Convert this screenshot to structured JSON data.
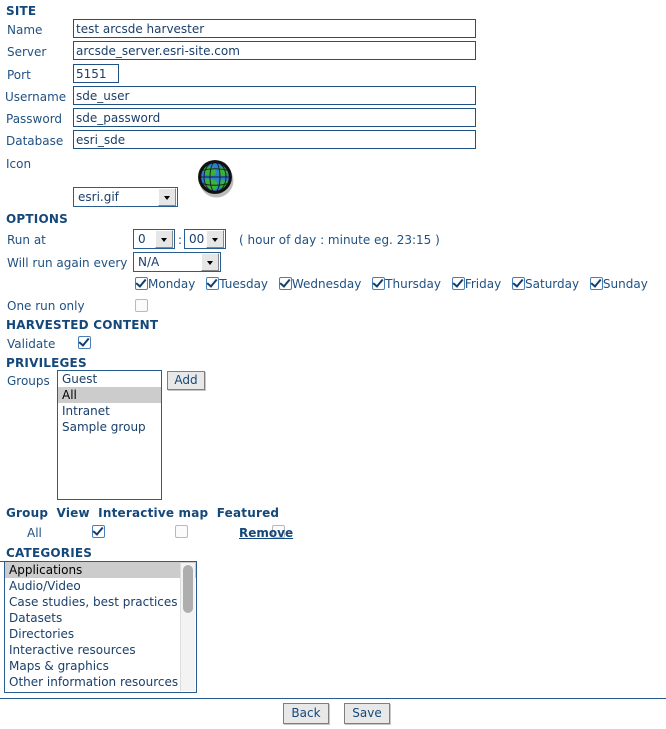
{
  "site": {
    "heading": "SITE",
    "fields": [
      {
        "label": "Name",
        "value": "test arcsde harvester"
      },
      {
        "label": "Server",
        "value": "arcsde_server.esri-site.com"
      },
      {
        "label": "Port",
        "value": "5151"
      },
      {
        "label": "Username",
        "value": "sde_user"
      },
      {
        "label": "Password",
        "value": "sde_password"
      },
      {
        "label": "Database",
        "value": "esri_sde"
      }
    ],
    "icon_label": "Icon",
    "icon_select_value": "esri.gif",
    "icon_preview_name": "esri-globe-icon"
  },
  "options": {
    "heading": "OPTIONS",
    "run_at_label": "Run at",
    "run_at_hour": "0",
    "run_at_separator": ":",
    "run_at_minute": "00",
    "run_at_hint": "( hour of day : minute eg. 23:15 )",
    "interval_label": "Will run again every",
    "interval_value": "N/A",
    "days": [
      {
        "label": "Monday",
        "checked": true
      },
      {
        "label": "Tuesday",
        "checked": true
      },
      {
        "label": "Wednesday",
        "checked": true
      },
      {
        "label": "Thursday",
        "checked": true
      },
      {
        "label": "Friday",
        "checked": true
      },
      {
        "label": "Saturday",
        "checked": true
      },
      {
        "label": "Sunday",
        "checked": true
      }
    ],
    "one_run_only_label": "One run only",
    "one_run_only_checked": false
  },
  "harvested_content": {
    "heading": "HARVESTED CONTENT",
    "validate_label": "Validate",
    "validate_checked": true
  },
  "privileges": {
    "heading": "PRIVILEGES",
    "groups_label": "Groups",
    "group_options": [
      "Guest",
      "All",
      "Intranet",
      "Sample group"
    ],
    "group_selected": "All",
    "add_button": "Add",
    "table_headers": [
      "Group",
      "View",
      "Interactive map",
      "Featured"
    ],
    "rows": [
      {
        "group": "All",
        "view": true,
        "interactive_map": false,
        "featured": false,
        "remove_label": "Remove"
      }
    ]
  },
  "categories": {
    "heading": "CATEGORIES",
    "options": [
      "Applications",
      "Audio/Video",
      "Case studies, best practices",
      "Datasets",
      "Directories",
      "Interactive resources",
      "Maps & graphics",
      "Other information resources"
    ],
    "selected": "Applications"
  },
  "footer": {
    "back_label": "Back",
    "save_label": "Save"
  },
  "colors": {
    "heading": "#14487a",
    "label": "#1f5182",
    "border": "#2a5d8f",
    "selection": "#cccccc"
  }
}
